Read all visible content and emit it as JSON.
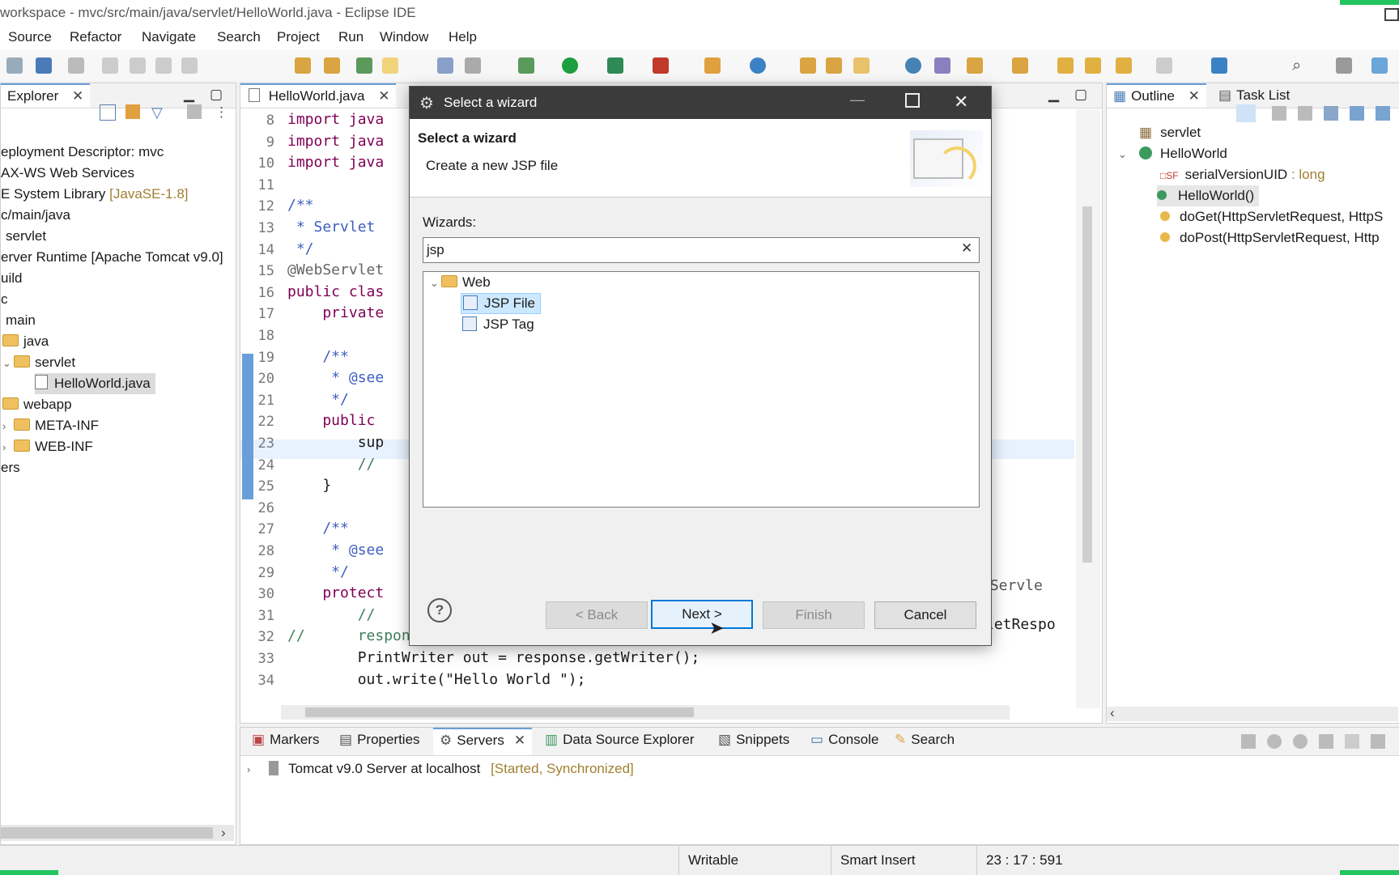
{
  "window": {
    "title": "workspace - mvc/src/main/java/servlet/HelloWorld.java - Eclipse IDE"
  },
  "menu": [
    "Source",
    "Refactor",
    "Navigate",
    "Search",
    "Project",
    "Run",
    "Window",
    "Help"
  ],
  "explorer": {
    "tab": "Explorer",
    "items": [
      "eployment Descriptor: mvc",
      "AX-WS Web Services",
      "E System Library",
      "c/main/java",
      "servlet",
      "erver Runtime [Apache Tomcat v9.0]",
      "uild",
      "c",
      "main",
      "java",
      "servlet",
      "HelloWorld.java",
      "webapp",
      "META-INF",
      "WEB-INF",
      "ers"
    ],
    "jre_suffix": "[JavaSE-1.8]"
  },
  "editor": {
    "tab": "HelloWorld.java",
    "line_numbers": [
      "8",
      "9",
      "10",
      "11",
      "12",
      "13",
      "14",
      "15",
      "16",
      "17",
      "18",
      "19",
      "20",
      "21",
      "22",
      "23",
      "24",
      "25",
      "26",
      "27",
      "28",
      "29",
      "30",
      "31",
      "32",
      "33",
      "34"
    ],
    "lines": [
      "import java",
      "import java",
      "import java",
      "",
      "/**",
      " * Servlet",
      " */",
      "@WebServlet",
      "public clas",
      "    private",
      "",
      "    /**",
      "     * @see",
      "     */",
      "    public",
      "        sup",
      "        //",
      "    }",
      "",
      "    /**",
      "     * @see",
      "     */",
      "    protect",
      "        //",
      "//      response.getWriter().append(\"Served at: \").append(request.ge",
      "        PrintWriter out = response.getWriter();",
      "        out.write(\"Hello World \");"
    ],
    "right_fragments": [
      "oServle",
      "letRespo"
    ]
  },
  "outline": {
    "tab_outline": "Outline",
    "tab_tasks": "Task List",
    "items": [
      "servlet",
      "HelloWorld",
      "serialVersionUID",
      "HelloWorld()",
      "doGet(HttpServletRequest, HttpS",
      "doPost(HttpServletRequest, Http"
    ],
    "field_type": ": long"
  },
  "bottom": {
    "tabs": [
      "Markers",
      "Properties",
      "Servers",
      "Data Source Explorer",
      "Snippets",
      "Console",
      "Search"
    ],
    "server": "Tomcat v9.0 Server at localhost",
    "server_state": "[Started, Synchronized]"
  },
  "dialog": {
    "title": "Select a wizard",
    "heading": "Select a wizard",
    "subheading": "Create a new JSP file",
    "wizards_label": "Wizards:",
    "filter_value": "jsp",
    "tree_category": "Web",
    "tree_items": [
      "JSP File",
      "JSP Tag"
    ],
    "buttons": {
      "back": "< Back",
      "next": "Next >",
      "finish": "Finish",
      "cancel": "Cancel"
    }
  },
  "status": {
    "writable": "Writable",
    "insert": "Smart Insert",
    "position": "23 : 17 : 591"
  }
}
